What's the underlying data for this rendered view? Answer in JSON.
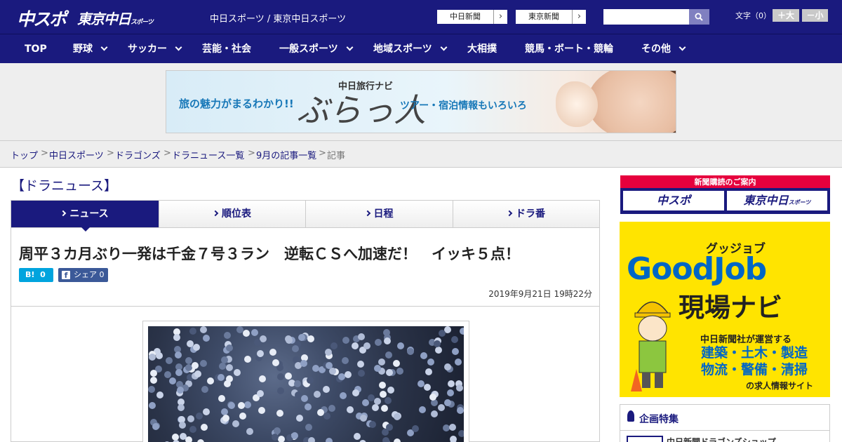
{
  "header": {
    "logo_primary": "中スポ",
    "logo_secondary": "東京中日",
    "logo_secondary_sub": "スポーツ",
    "site_names": "中日スポーツ / 東京中日スポーツ",
    "links": [
      "中日新聞",
      "東京新聞"
    ],
    "search_placeholder": "",
    "font_size_label": "文字（0）",
    "font_plus": "＋大",
    "font_minus": "－小"
  },
  "nav": {
    "items": [
      {
        "label": "TOP",
        "has_dropdown": false
      },
      {
        "label": "野球",
        "has_dropdown": true
      },
      {
        "label": "サッカー",
        "has_dropdown": true
      },
      {
        "label": "芸能・社会",
        "has_dropdown": false
      },
      {
        "label": "一般スポーツ",
        "has_dropdown": true
      },
      {
        "label": "地域スポーツ",
        "has_dropdown": true
      },
      {
        "label": "大相撲",
        "has_dropdown": false
      },
      {
        "label": "競馬・ボート・競輪",
        "has_dropdown": false
      },
      {
        "label": "その他",
        "has_dropdown": true
      }
    ]
  },
  "ad_banner": {
    "lead": "旅の魅力がまるわかり!!",
    "brand_small": "中日旅行ナビ",
    "brand": "ぶらっ人",
    "tail": "ツアー・宿泊情報もいろいろ"
  },
  "breadcrumb": {
    "items": [
      "トップ",
      "中日スポーツ",
      "ドラゴンズ",
      "ドラニュース一覧",
      "9月の記事一覧",
      "記事"
    ],
    "separator": ">"
  },
  "section_title": "【ドラニュース】",
  "tabs": [
    {
      "label": "ニュース",
      "active": true
    },
    {
      "label": "順位表",
      "active": false
    },
    {
      "label": "日程",
      "active": false
    },
    {
      "label": "ドラ番",
      "active": false
    }
  ],
  "article": {
    "headline": "周平３カ月ぶり一発は千金７号３ラン　逆転ＣＳへ加速だ！　イッキ５点！",
    "hatena_label": "B!",
    "hatena_count": "0",
    "facebook_label": "シェア",
    "facebook_count": "0",
    "date": "2019年9月21日 19時22分"
  },
  "sidebar": {
    "subscribe_title": "新聞購読のご案内",
    "subscribe_links": [
      "中スポ",
      "東京中日"
    ],
    "subscribe_link2_sub": "スポーツ",
    "goodjob": {
      "kana": "グッジョブ",
      "title": "GoodJob",
      "subtitle": "現場ナビ",
      "operator": "中日新聞社が運営する",
      "fields_line1": "建築・土木・製造",
      "fields_line2": "物流・警備・清掃",
      "tail": "の求人情報サイト"
    },
    "feature_title": "企画特集",
    "feature_item": "中日新聞ドラゴンズショップ"
  },
  "colors": {
    "brand_navy": "#1a1a7e",
    "hatena_blue": "#00a4de",
    "facebook_blue": "#3b5998",
    "subscribe_red": "#e6003d",
    "goodjob_yellow": "#ffe400"
  }
}
